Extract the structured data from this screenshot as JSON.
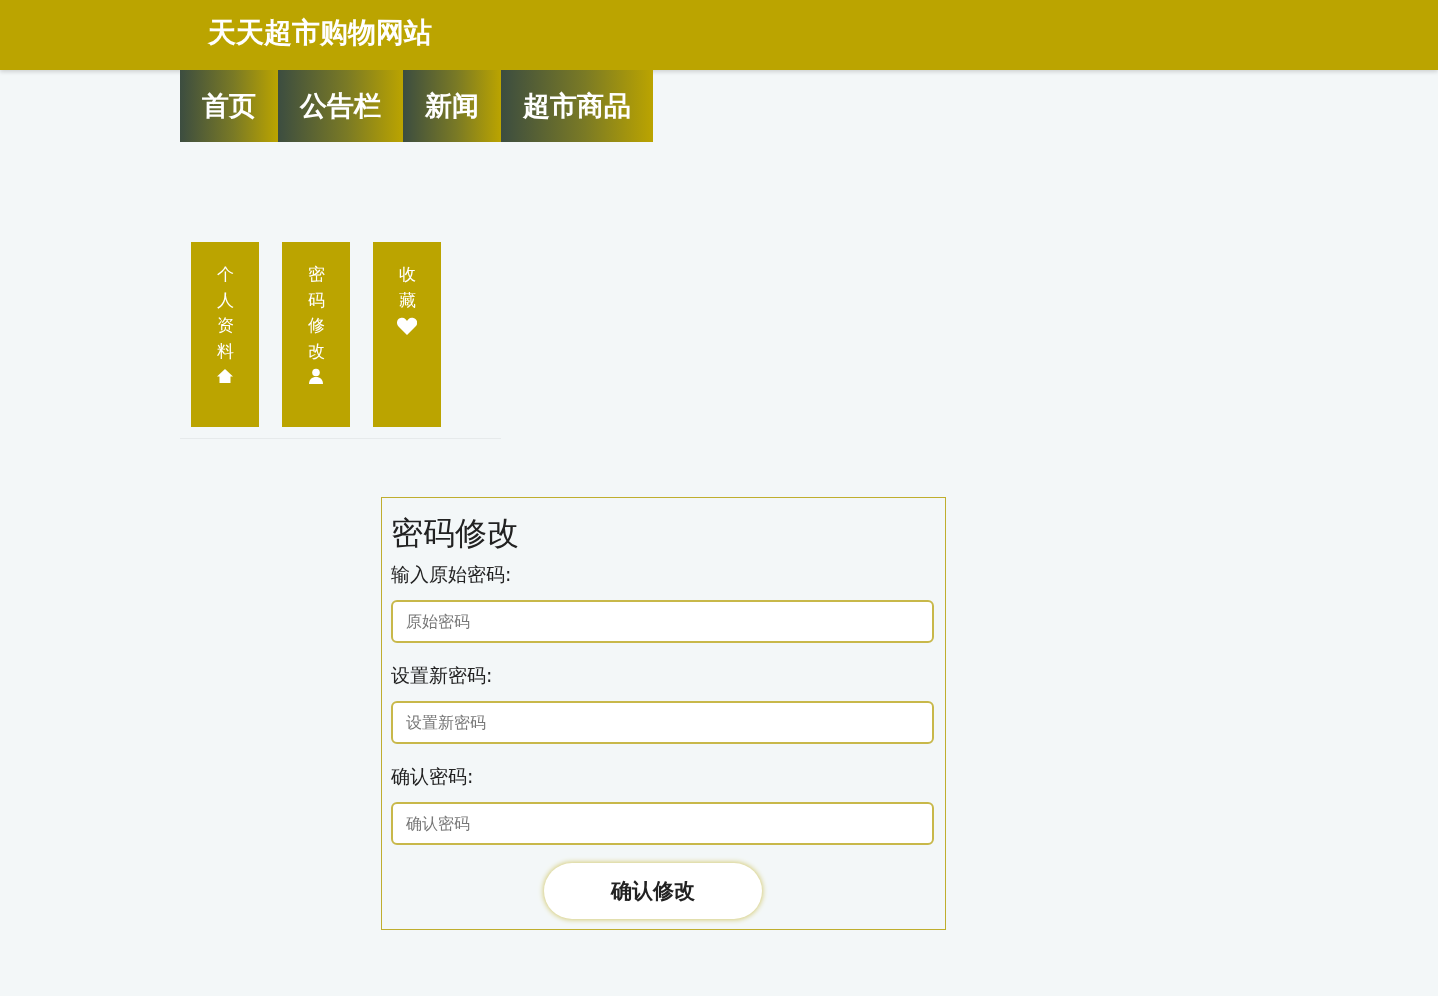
{
  "header": {
    "title": "天天超市购物网站"
  },
  "nav": [
    {
      "label": "首页"
    },
    {
      "label": "公告栏"
    },
    {
      "label": "新闻"
    },
    {
      "label": "超市商品"
    }
  ],
  "side_tabs": [
    {
      "label": "个人资料"
    },
    {
      "label": "密码修改"
    },
    {
      "label": "收藏"
    }
  ],
  "form": {
    "title": "密码修改",
    "fields": [
      {
        "label": "输入原始密码:",
        "placeholder": "原始密码"
      },
      {
        "label": "设置新密码:",
        "placeholder": "设置新密码"
      },
      {
        "label": "确认密码:",
        "placeholder": "确认密码"
      }
    ],
    "submit": "确认修改"
  }
}
